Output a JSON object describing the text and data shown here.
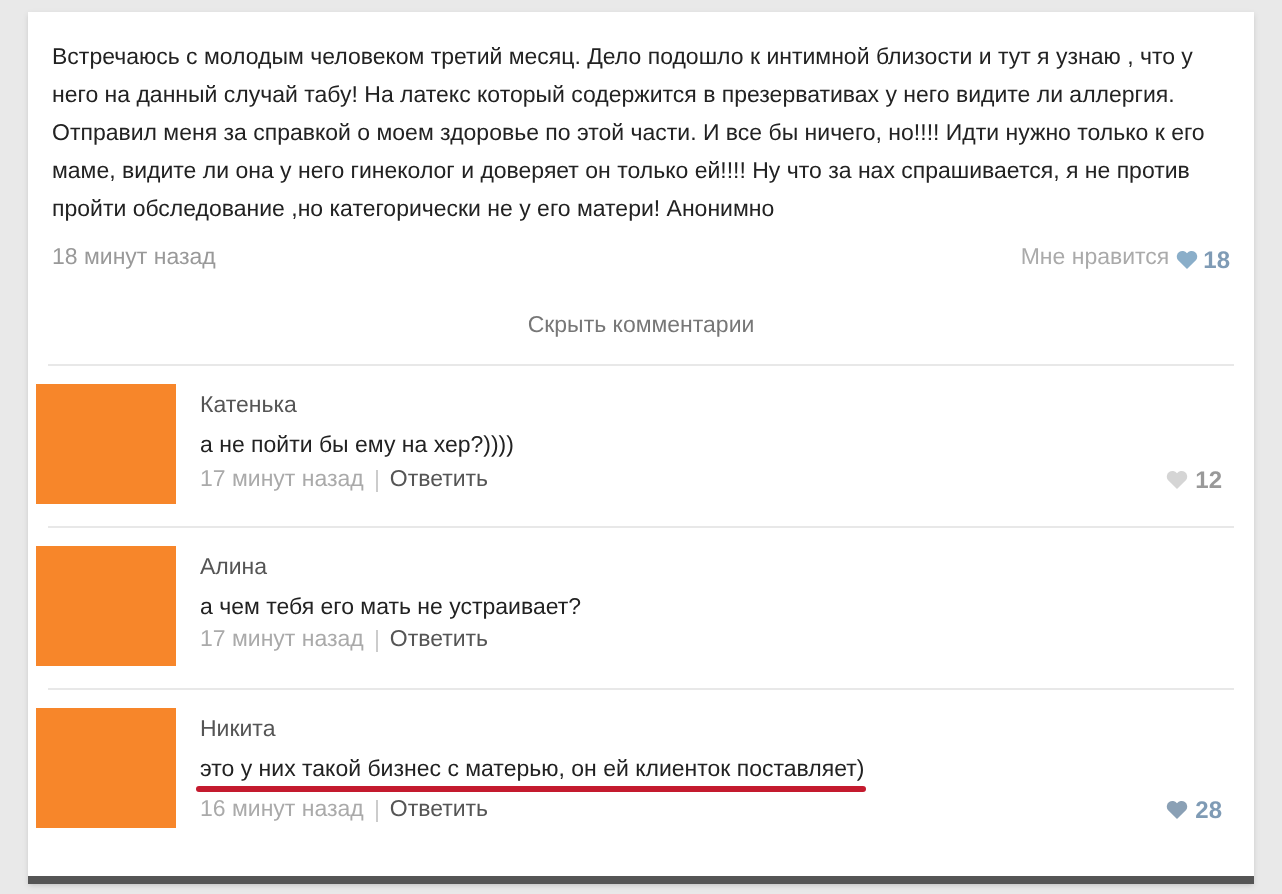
{
  "post": {
    "text": "Встречаюсь с молодым человеком третий месяц. Дело подошло к интимной близости и тут я узнаю , что у него на данный случай табу! На латекс который содержится в презервативах у него видите ли аллергия. Отправил меня за справкой о моем здоровье по этой части. И все бы ничего, но!!!! Идти нужно только к его маме, видите ли она у него гинеколог и доверяет он только ей!!!! Ну что за нах спрашивается, я не против пройти обследование ,но категорически не у его матери! Анонимно",
    "time": "18 минут назад",
    "like_label": "Мне нравится",
    "likes": "18"
  },
  "hide_comments": "Скрыть комментарии",
  "comments": [
    {
      "author": "Катенька",
      "text": "а не пойти бы ему на хер?))))",
      "time": "17 минут назад",
      "reply": "Ответить",
      "likes": "12",
      "underlined": false
    },
    {
      "author": "Алина",
      "text": "а чем тебя его мать не устраивает?",
      "time": "17 минут назад",
      "reply": "Ответить",
      "underlined": false
    },
    {
      "author": "Никита",
      "text": "это у них такой бизнес с матерью, он ей клиенток поставляет)",
      "time": "16 минут назад",
      "reply": "Ответить",
      "likes": "28",
      "underlined": true
    }
  ]
}
